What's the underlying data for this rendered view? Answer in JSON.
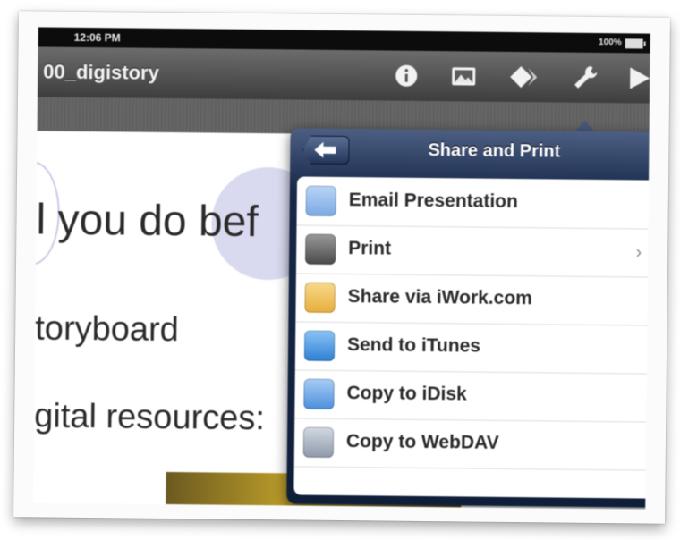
{
  "status_bar": {
    "time": "12:06 PM",
    "battery": "100%"
  },
  "toolbar": {
    "title": "00_digistory",
    "buttons": [
      "info-icon",
      "media-icon",
      "animation-icon",
      "wrench-icon",
      "play-icon"
    ]
  },
  "slide": {
    "lines": [
      "l you do bef",
      "toryboard",
      "gital resources:"
    ]
  },
  "popover": {
    "title": "Share and Print",
    "items": [
      {
        "label": "Email Presentation",
        "icon": "mail-icon",
        "color": "#8fb8ec",
        "chevron": ""
      },
      {
        "label": "Print",
        "icon": "printer-icon",
        "color": "#6d6d6d",
        "chevron": "›"
      },
      {
        "label": "Share via iWork.com",
        "icon": "iwork-icon",
        "color": "#f0c25a",
        "chevron": ""
      },
      {
        "label": "Send to iTunes",
        "icon": "itunes-icon",
        "color": "#4f9be6",
        "chevron": ""
      },
      {
        "label": "Copy to iDisk",
        "icon": "idisk-icon",
        "color": "#6aa6e8",
        "chevron": ""
      },
      {
        "label": "Copy to WebDAV",
        "icon": "webdav-icon",
        "color": "#a9b3c3",
        "chevron": ""
      }
    ]
  },
  "colors": {
    "popover_bg": "#172848",
    "toolbar_bg": "#4a4a4a"
  }
}
